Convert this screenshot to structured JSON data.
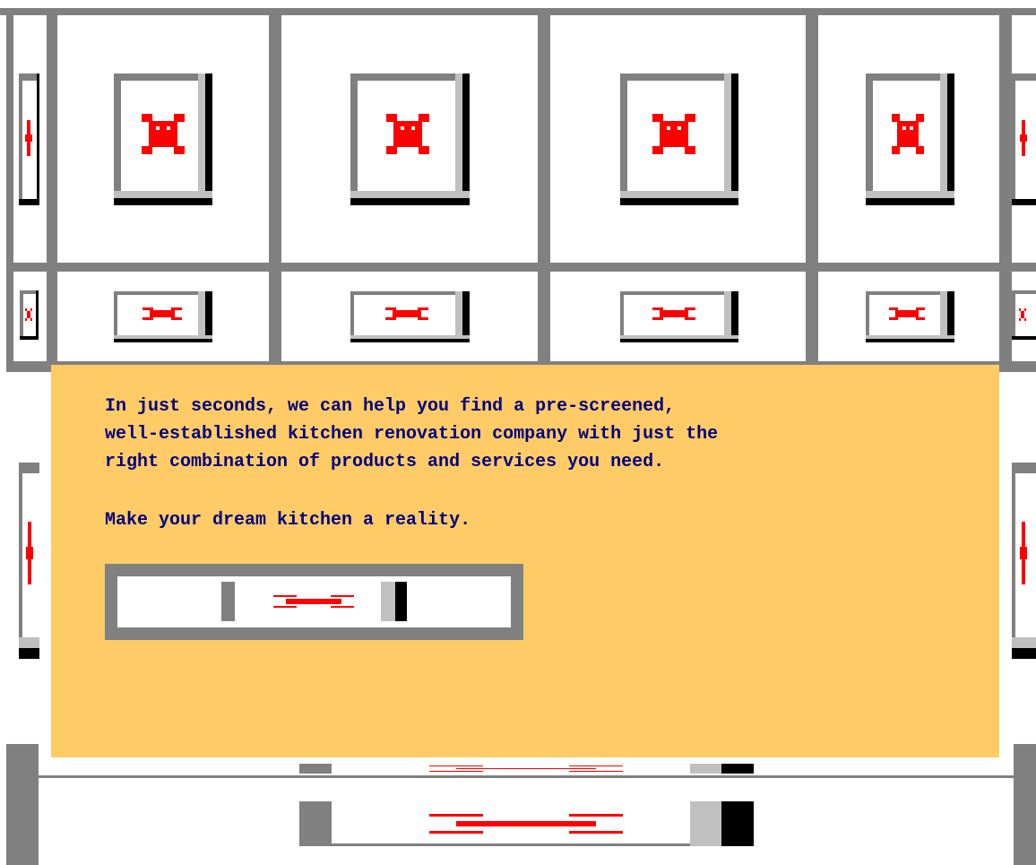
{
  "colors": {
    "grid": "#808080",
    "promo_background": "#fecb66",
    "promo_text": "#000080",
    "broken_icon": "#ff0000"
  },
  "promo": {
    "paragraph_lines": [
      "In just seconds, we can help you find a pre-screened,",
      "well-established kitchen renovation company with just the",
      "right combination of products and services you need."
    ],
    "tagline": "Make your dream kitchen a reality."
  },
  "icons": {
    "placeholder": "broken-image-icon"
  }
}
